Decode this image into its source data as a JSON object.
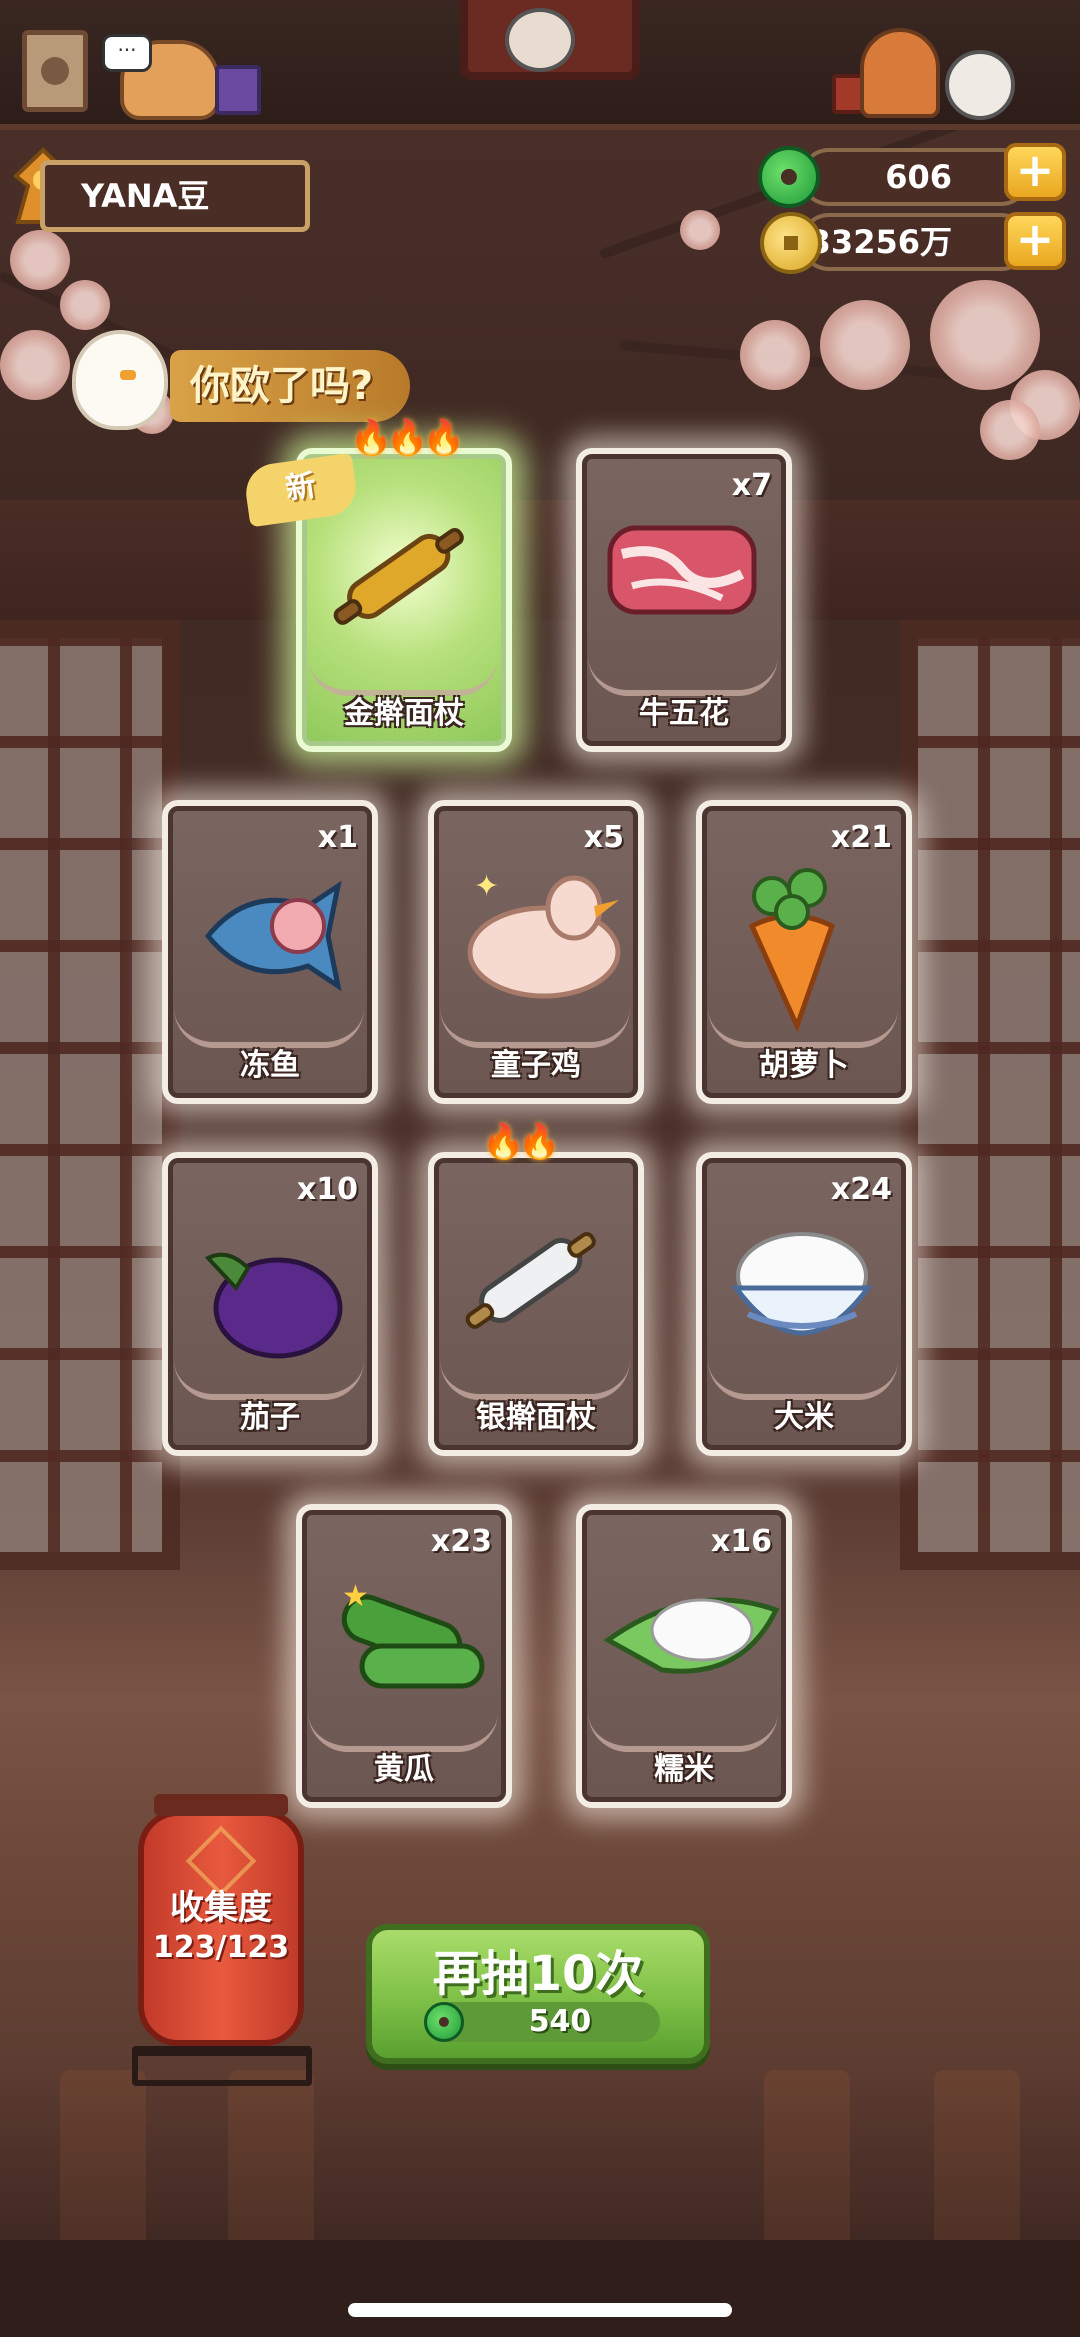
{
  "player": {
    "name": "YANA豆"
  },
  "currency": {
    "jade": "606",
    "gold": "33256万",
    "add_symbol": "+"
  },
  "banner": {
    "text": "你欧了吗?"
  },
  "new_badge": "新",
  "cards": [
    {
      "name": "金擀面杖",
      "count": "",
      "flames": "🔥🔥🔥",
      "is_new": true,
      "icon": "golden-rolling-pin-icon"
    },
    {
      "name": "牛五花",
      "count": "x7",
      "flames": "",
      "is_new": false,
      "icon": "beef-belly-icon"
    },
    {
      "name": "冻鱼",
      "count": "x1",
      "flames": "",
      "is_new": false,
      "icon": "frozen-fish-icon"
    },
    {
      "name": "童子鸡",
      "count": "x5",
      "flames": "",
      "is_new": false,
      "icon": "young-chicken-icon"
    },
    {
      "name": "胡萝卜",
      "count": "x21",
      "flames": "",
      "is_new": false,
      "icon": "carrot-icon"
    },
    {
      "name": "茄子",
      "count": "x10",
      "flames": "",
      "is_new": false,
      "icon": "eggplant-icon"
    },
    {
      "name": "银擀面杖",
      "count": "",
      "flames": "🔥🔥",
      "is_new": false,
      "icon": "silver-rolling-pin-icon"
    },
    {
      "name": "大米",
      "count": "x24",
      "flames": "",
      "is_new": false,
      "icon": "rice-bowl-icon"
    },
    {
      "name": "黄瓜",
      "count": "x23",
      "flames": "",
      "is_new": false,
      "icon": "cucumber-icon"
    },
    {
      "name": "糯米",
      "count": "x16",
      "flames": "",
      "is_new": false,
      "icon": "glutinous-rice-icon"
    }
  ],
  "collection": {
    "title": "收集度",
    "progress": "123/123"
  },
  "draw_again": {
    "label": "再抽10次",
    "cost": "540"
  },
  "colors": {
    "accent_green": "#7ec047",
    "jade": "#1f9a3a",
    "gold": "#d9a520",
    "lantern_red": "#e85a3e"
  }
}
